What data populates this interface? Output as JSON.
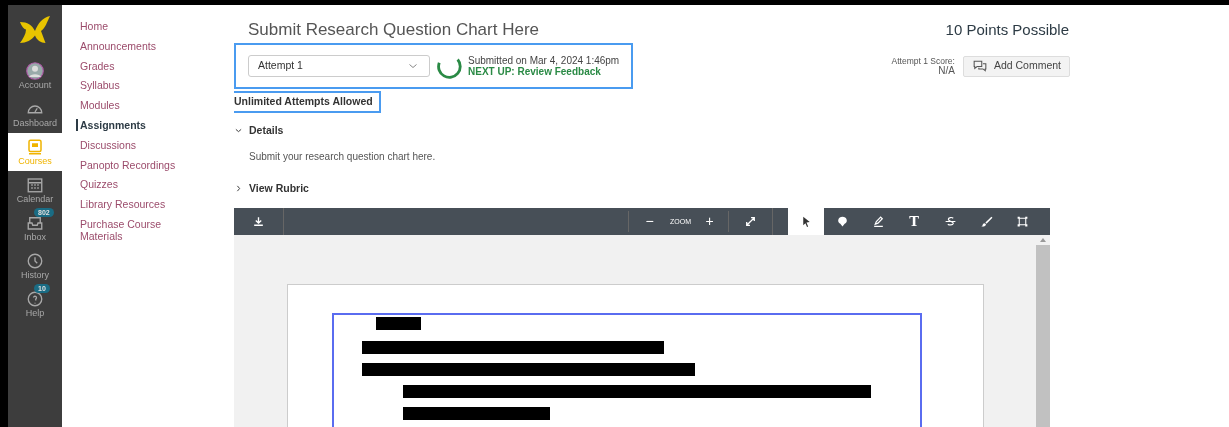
{
  "global_nav": [
    {
      "label": "Account",
      "kind": "account",
      "selected": false
    },
    {
      "label": "Dashboard",
      "kind": "dashboard",
      "selected": false
    },
    {
      "label": "Courses",
      "kind": "courses",
      "selected": true
    },
    {
      "label": "Calendar",
      "kind": "calendar",
      "selected": false
    },
    {
      "label": "Inbox",
      "kind": "inbox",
      "selected": false,
      "badge": "802"
    },
    {
      "label": "History",
      "kind": "history",
      "selected": false
    },
    {
      "label": "Help",
      "kind": "help",
      "selected": false,
      "badge": "10"
    }
  ],
  "course_nav": [
    {
      "label": "Home",
      "selected": false
    },
    {
      "label": "Announcements",
      "selected": false
    },
    {
      "label": "Grades",
      "selected": false
    },
    {
      "label": "Syllabus",
      "selected": false
    },
    {
      "label": "Modules",
      "selected": false
    },
    {
      "label": "Assignments",
      "selected": true
    },
    {
      "label": "Discussions",
      "selected": false
    },
    {
      "label": "Panopto Recordings",
      "selected": false
    },
    {
      "label": "Quizzes",
      "selected": false
    },
    {
      "label": "Library Resources",
      "selected": false
    },
    {
      "label": "Purchase Course Materials",
      "selected": false
    }
  ],
  "assignment": {
    "title": "Submit Research Question Chart Here",
    "points": "10 Points Possible",
    "attempt_select": "Attempt 1",
    "submitted": "Submitted on Mar 4, 2024 1:46pm",
    "next_up": "NEXT UP: Review Feedback",
    "score_label": "Attempt 1 Score:",
    "score": "N/A",
    "comment_button": "Add Comment",
    "attempts_allowed": "Unlimited Attempts Allowed",
    "details": {
      "label": "Details",
      "expanded": true,
      "text": "Submit your research question chart here."
    },
    "rubric": {
      "label": "View Rubric",
      "expanded": false
    }
  },
  "viewer_toolbar": {
    "zoom_label": "ZOOM",
    "zoom_out": "−",
    "zoom_in": "+",
    "tools": [
      {
        "kind": "pointer",
        "selected": true
      },
      {
        "kind": "comment",
        "selected": false
      },
      {
        "kind": "highlight",
        "selected": false
      },
      {
        "kind": "text",
        "label": "T",
        "selected": false
      },
      {
        "kind": "strike",
        "selected": false
      },
      {
        "kind": "draw",
        "selected": false
      },
      {
        "kind": "area",
        "selected": false
      }
    ]
  }
}
